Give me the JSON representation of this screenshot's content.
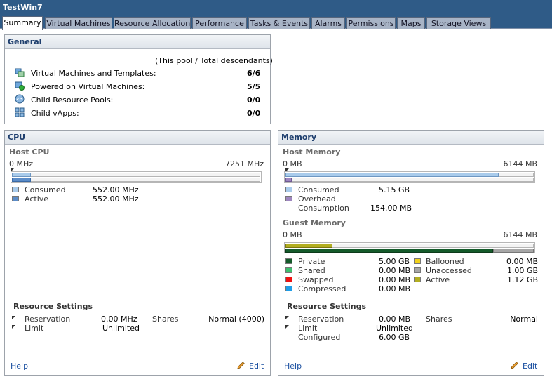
{
  "window": {
    "title": "TestWin7"
  },
  "tabs": [
    {
      "label": "Summary",
      "active": true
    },
    {
      "label": "Virtual Machines"
    },
    {
      "label": "Resource Allocation"
    },
    {
      "label": "Performance"
    },
    {
      "label": "Tasks & Events"
    },
    {
      "label": "Alarms"
    },
    {
      "label": "Permissions"
    },
    {
      "label": "Maps"
    },
    {
      "label": "Storage Views"
    }
  ],
  "general": {
    "title": "General",
    "note": "(This pool / Total descendants)",
    "rows": [
      {
        "label": "Virtual Machines and Templates:",
        "value": "6/6",
        "icon": "vm-templates-icon"
      },
      {
        "label": "Powered on Virtual Machines:",
        "value": "5/5",
        "icon": "powered-on-vm-icon"
      },
      {
        "label": "Child Resource Pools:",
        "value": "0/0",
        "icon": "resource-pool-icon"
      },
      {
        "label": "Child vApps:",
        "value": "0/0",
        "icon": "vapp-icon"
      }
    ]
  },
  "cpu": {
    "title": "CPU",
    "host_title": "Host CPU",
    "scale_min": "0 MHz",
    "scale_max": "7251 MHz",
    "consumed_fraction": 0.076,
    "active_fraction": 0.076,
    "legend": [
      {
        "label": "Consumed",
        "value": "552.00 MHz",
        "color": "#a9cbeb"
      },
      {
        "label": "Active",
        "value": "552.00 MHz",
        "color": "#5b8cc8"
      }
    ],
    "resource_settings": {
      "title": "Resource Settings",
      "reservation_label": "Reservation",
      "reservation_value": "0.00 MHz",
      "limit_label": "Limit",
      "limit_value": "Unlimited",
      "shares_label": "Shares",
      "shares_value": "Normal (4000)"
    },
    "help": "Help",
    "edit": "Edit"
  },
  "memory": {
    "title": "Memory",
    "host_title": "Host Memory",
    "scale_min": "0 MB",
    "scale_max": "6144 MB",
    "consumed_fraction": 0.86,
    "overhead_fraction": 0.025,
    "host_legend": [
      {
        "label": "Consumed",
        "value": "5.15 GB",
        "color": "#a9cbeb"
      },
      {
        "label": "Overhead",
        "value": "",
        "color": "#9e86bf"
      },
      {
        "label": "Consumption",
        "value": "154.00 MB",
        "color": ""
      }
    ],
    "guest_title": "Guest Memory",
    "guest_scale_min": "0 MB",
    "guest_scale_max": "6144 MB",
    "guest_active_fraction": 0.19,
    "guest_private_fraction": 0.835,
    "guest_unaccessed_fraction": 0.165,
    "guest_legend_left": [
      {
        "label": "Private",
        "value": "5.00 GB",
        "color": "#145a2a"
      },
      {
        "label": "Shared",
        "value": "0.00 MB",
        "color": "#3cbf6e"
      },
      {
        "label": "Swapped",
        "value": "0.00 MB",
        "color": "#ee1111"
      },
      {
        "label": "Compressed",
        "value": "0.00 MB",
        "color": "#1e9de8"
      }
    ],
    "guest_legend_right": [
      {
        "label": "Ballooned",
        "value": "0.00 MB",
        "color": "#f2d21a"
      },
      {
        "label": "Unaccessed",
        "value": "1.00 GB",
        "color": "#a6a6a6"
      },
      {
        "label": "Active",
        "value": "1.12 GB",
        "color": "#b2ae20"
      }
    ],
    "resource_settings": {
      "title": "Resource Settings",
      "reservation_label": "Reservation",
      "reservation_value": "0.00 MB",
      "limit_label": "Limit",
      "limit_value": "Unlimited",
      "configured_label": "Configured",
      "configured_value": "6.00 GB",
      "shares_label": "Shares",
      "shares_value": "Normal"
    },
    "help": "Help",
    "edit": "Edit"
  }
}
